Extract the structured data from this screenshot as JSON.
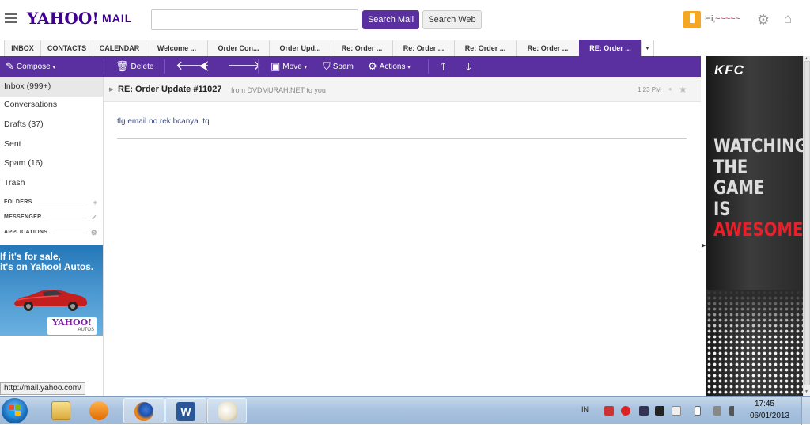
{
  "header": {
    "logo_text": "YAHOO!",
    "logo_sub": "MAIL",
    "search_placeholder": "",
    "search_mail_label": "Search Mail",
    "search_web_label": "Search Web",
    "greeting": "Hi,",
    "user_name": "~~~~~"
  },
  "tabs": [
    {
      "label": "INBOX"
    },
    {
      "label": "CONTACTS"
    },
    {
      "label": "CALENDAR"
    },
    {
      "label": "Welcome ..."
    },
    {
      "label": "Order Con..."
    },
    {
      "label": "Order Upd..."
    },
    {
      "label": "Re: Order ..."
    },
    {
      "label": "Re: Order ..."
    },
    {
      "label": "Re: Order ..."
    },
    {
      "label": "Re: Order ..."
    },
    {
      "label": "RE: Order ..."
    }
  ],
  "tab_more_icon": "▼",
  "toolbar": {
    "compose": "Compose",
    "delete": "Delete",
    "move": "Move",
    "spam": "Spam",
    "actions": "Actions"
  },
  "sidebar": {
    "items": [
      {
        "label": "Inbox (999+)"
      },
      {
        "label": "Conversations"
      },
      {
        "label": "Drafts (37)"
      },
      {
        "label": "Sent"
      },
      {
        "label": "Spam (16)"
      },
      {
        "label": "Trash"
      }
    ],
    "sections": [
      {
        "label": "FOLDERS",
        "action": "+"
      },
      {
        "label": "MESSENGER",
        "action": "✓"
      },
      {
        "label": "APPLICATIONS",
        "action": "⚙"
      }
    ]
  },
  "ad_left": {
    "line1": "If it's for sale,",
    "line2": "it's on Yahoo! Autos.",
    "logo": "YAHOO!",
    "logo_sub": "AUTOS"
  },
  "message": {
    "subject": "RE: Order Update #11027",
    "from": "from DVDMURAH.NET to you",
    "time": "1:23 PM",
    "body": "tlg email no rek bcanya. tq"
  },
  "ad_right": {
    "brand": "KFC",
    "line1": "WATCHING",
    "line2": "THE",
    "line3": "GAME",
    "line4": "IS",
    "line5": "AWESOME"
  },
  "status_url": "http://mail.yahoo.com/",
  "taskbar": {
    "lang": "IN",
    "time": "17:45",
    "date": "06/01/2013"
  },
  "colors": {
    "brand_purple": "#5a2fa0",
    "logo_purple": "#400090",
    "kfc_red": "#e8202a"
  }
}
